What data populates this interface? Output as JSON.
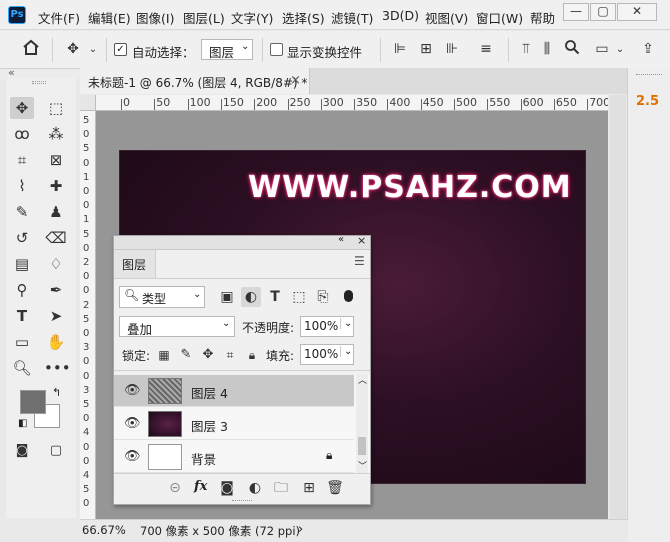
{
  "app": {
    "logo": "Ps"
  },
  "menu": {
    "items": [
      "文件(F)",
      "编辑(E)",
      "图像(I)",
      "图层(L)",
      "文字(Y)",
      "选择(S)",
      "滤镜(T)",
      "3D(D)",
      "视图(V)",
      "窗口(W)",
      "帮助"
    ],
    "window_controls": {
      "minimize": "—",
      "maximize": "▢",
      "close": "✕"
    }
  },
  "options": {
    "auto_select_label": "自动选择：",
    "auto_select_checked": true,
    "auto_select_target": "图层",
    "show_transform_label": "显示变换控件",
    "show_transform_checked": false
  },
  "panel_strip": {
    "collapse_left": "«",
    "collapse_right": "«"
  },
  "document": {
    "tab_title": "未标题-1 @ 66.7% (图层 4, RGB/8#) *",
    "tab_close": "×",
    "watermark_text": "WWW.PSAHZ.COM",
    "canvas_colors": {
      "center": "#4a1c36",
      "edge": "#1a0915"
    }
  },
  "ruler": {
    "top_labels": [
      "0",
      "0",
      "50",
      "100",
      "150",
      "200",
      "250",
      "300",
      "350",
      "400",
      "450",
      "500",
      "550",
      "600",
      "650",
      "700"
    ],
    "left_labels": [
      "5",
      "0",
      "5",
      "0",
      "1",
      "0",
      "0",
      "1",
      "5",
      "0",
      "2",
      "0",
      "0",
      "2",
      "5",
      "0",
      "3",
      "0",
      "0",
      "3",
      "5",
      "0",
      "4",
      "0",
      "0",
      "4",
      "5",
      "0"
    ]
  },
  "status": {
    "zoom": "66.67%",
    "doc_info": "700 像素 x 500 像素 (72 ppi)",
    "arrow": "›"
  },
  "right_panel": {
    "value": "2.5",
    "value_color": "#e07000"
  },
  "layers_panel": {
    "title": "图层",
    "filter_kind": "类型",
    "blend_mode": "叠加",
    "opacity_label": "不透明度:",
    "opacity_value": "100%",
    "lock_label": "锁定:",
    "fill_label": "填充:",
    "fill_value": "100%",
    "layers": [
      {
        "name": "图层 4",
        "selected": true,
        "visible": true,
        "locked": false,
        "thumb": "texture"
      },
      {
        "name": "图层 3",
        "selected": false,
        "visible": true,
        "locked": false,
        "thumb": "dark"
      },
      {
        "name": "背景",
        "selected": false,
        "visible": true,
        "locked": true,
        "thumb": "white"
      }
    ],
    "footer_icons": [
      "link-icon",
      "fx-icon",
      "mask-icon",
      "adjustment-icon",
      "folder-icon",
      "new-layer-icon",
      "trash-icon"
    ],
    "fx_label": "fx"
  }
}
